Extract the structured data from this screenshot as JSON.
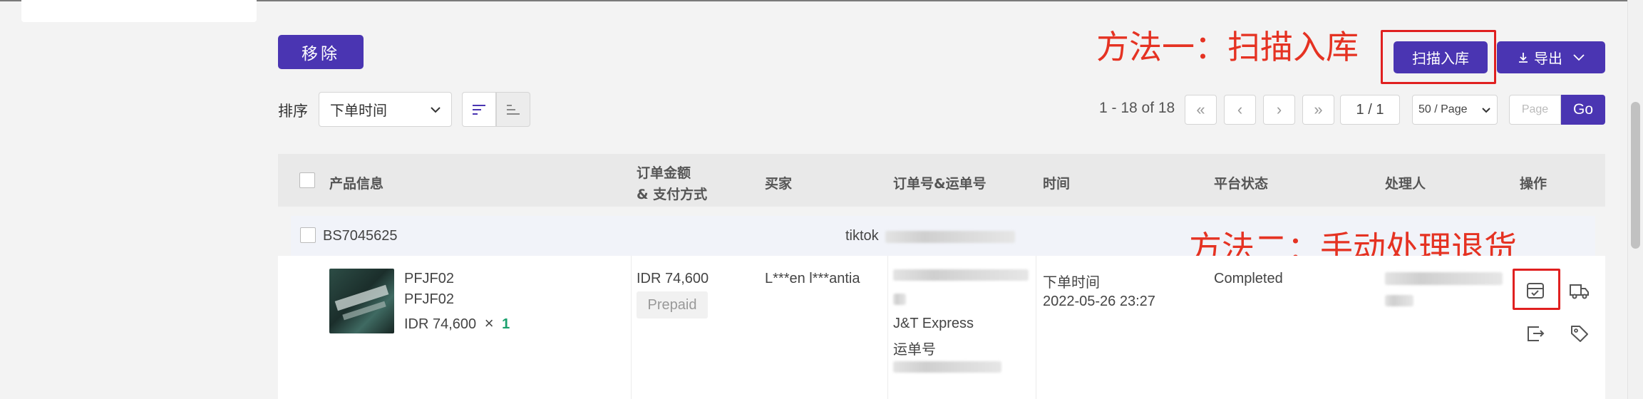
{
  "toolbar": {
    "remove_label": "移除",
    "scan_in_label": "扫描入库",
    "export_label": "导出"
  },
  "annotations": {
    "method_one": "方法一：扫描入库",
    "method_two": "方法二：手动处理退货"
  },
  "sort": {
    "label": "排序",
    "selected": "下单时间"
  },
  "pagination": {
    "summary": "1 - 18 of 18",
    "first": "«",
    "prev": "‹",
    "next": "›",
    "last": "»",
    "current": "1 / 1",
    "page_size": "50 / Page",
    "page_input_placeholder": "Page",
    "go_label": "Go"
  },
  "table": {
    "headers": {
      "product_info": "产品信息",
      "amount_line1": "订单金额",
      "amount_line2": "& 支付方式",
      "buyer": "买家",
      "order_tracking": "订单号&运单号",
      "time": "时间",
      "platform_status": "平台状态",
      "handler": "处理人",
      "actions": "操作"
    },
    "order": {
      "id": "BS7045625",
      "platform": "tiktok",
      "product_sku": "PFJF02",
      "product_name": "PFJF02",
      "product_price": "IDR 74,600",
      "times_sign": "×",
      "quantity": "1",
      "amount": "IDR 74,600",
      "payment": "Prepaid",
      "buyer": "L***en l***antia",
      "carrier": "J&T Express",
      "tracking_label": "运单号",
      "time_label": "下单时间",
      "time_value": "2022-05-26 23:27",
      "status": "Completed"
    }
  },
  "colors": {
    "primary": "#4a35b2",
    "annotation": "#e53222",
    "quantity": "#1aa06d"
  }
}
